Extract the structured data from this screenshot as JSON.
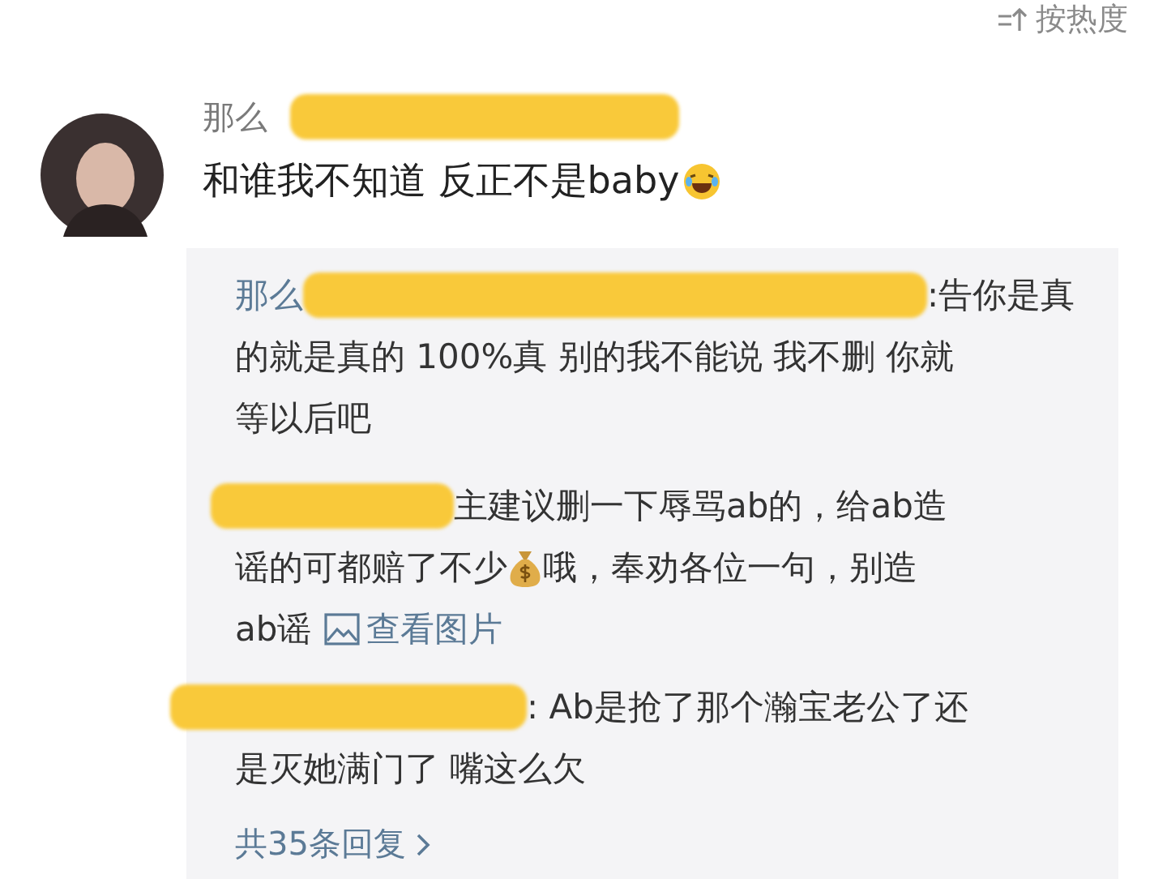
{
  "sort": {
    "label": "按热度"
  },
  "comment": {
    "author": "那么",
    "author_redacted": true,
    "text": "和谁我不知道 反正不是baby"
  },
  "replies": [
    {
      "author": "那么",
      "redacted": true,
      "lines": [
        [
          {
            "kind": "text",
            "text": ":告你是真"
          }
        ],
        [
          {
            "kind": "text",
            "text": "的就是真的 100%真 别的我不能说 我不删 你就"
          }
        ],
        [
          {
            "kind": "text",
            "text": "等以后吧"
          }
        ]
      ]
    },
    {
      "redacted": true,
      "lines": [
        [
          {
            "kind": "text",
            "text": "主建议删一下辱骂ab的，给ab造"
          }
        ],
        [
          {
            "kind": "text",
            "text": "谣的可都赔了不少"
          },
          {
            "kind": "money_icon"
          },
          {
            "kind": "text",
            "text": "哦，奉劝各位一句，别造"
          }
        ],
        [
          {
            "kind": "text",
            "text": "ab谣"
          },
          {
            "kind": "link",
            "text": "查看图片"
          }
        ]
      ]
    },
    {
      "redacted": true,
      "lines": [
        [
          {
            "kind": "text",
            "text": ": Ab是抢了那个瀚宝老公了还"
          }
        ],
        [
          {
            "kind": "text",
            "text": "是灭她满门了  嘴这么欠"
          }
        ]
      ]
    }
  ],
  "more_replies": "共35条回复"
}
